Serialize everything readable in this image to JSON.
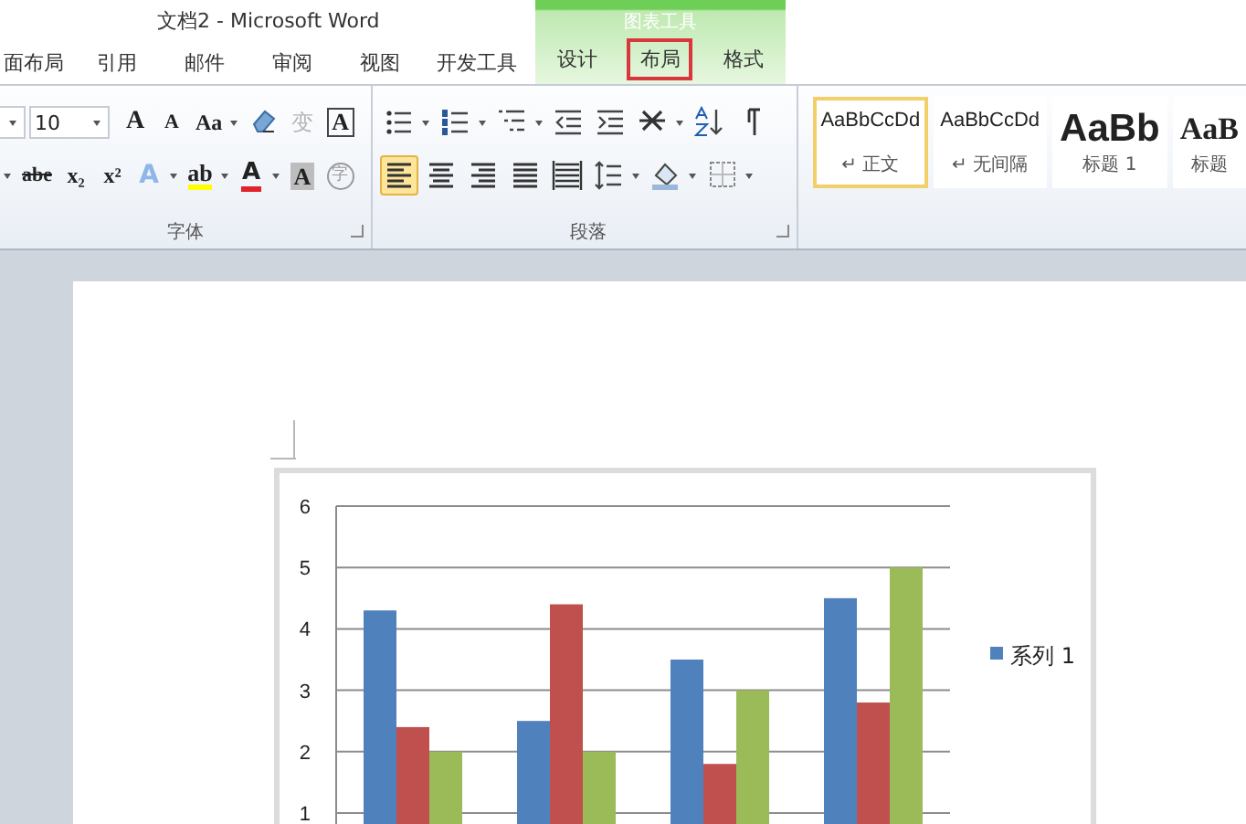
{
  "window": {
    "title": "文档2 - Microsoft Word"
  },
  "tabs": [
    {
      "label": "面布局",
      "highlighted": false
    },
    {
      "label": "引用",
      "highlighted": false
    },
    {
      "label": "邮件",
      "highlighted": false
    },
    {
      "label": "审阅",
      "highlighted": false
    },
    {
      "label": "视图",
      "highlighted": false
    },
    {
      "label": "开发工具",
      "highlighted": false
    }
  ],
  "contextual_tabs": {
    "title": "图表工具",
    "tabs": [
      {
        "label": "设计",
        "highlighted": false
      },
      {
        "label": "布局",
        "highlighted": true
      },
      {
        "label": "格式",
        "highlighted": false
      }
    ]
  },
  "font_group": {
    "label": "字体",
    "font_size": "10",
    "row1": [
      "A",
      "A",
      "Aa",
      "变",
      "A"
    ],
    "row2": [
      "abe",
      "x₂",
      "x²",
      "A",
      "ab",
      "A",
      "A",
      "字"
    ]
  },
  "paragraph_group": {
    "label": "段落",
    "align_buttons": [
      {
        "selected": true
      },
      {
        "selected": false
      },
      {
        "selected": false
      },
      {
        "selected": false
      },
      {
        "selected": false
      }
    ]
  },
  "styles": [
    {
      "sample": "AaBbCcDd",
      "name": "正文",
      "mark": "↵",
      "selected": true
    },
    {
      "sample": "AaBbCcDd",
      "name": "无间隔",
      "mark": "↵",
      "selected": false
    },
    {
      "sample": "AaBb",
      "name": "标题 1",
      "selected": false
    },
    {
      "sample": "AaB",
      "name": "标题",
      "selected": false
    }
  ],
  "chart": {
    "chart_data": {
      "type": "bar",
      "ylim": [
        0,
        6
      ],
      "yticks": [
        1,
        2,
        3,
        4,
        5,
        6
      ],
      "grid": true,
      "series": [
        {
          "name": "系列 1",
          "color": "#4f81bd",
          "values": [
            4.3,
            2.5,
            3.5,
            4.5
          ]
        },
        {
          "color": "#c0504d",
          "values": [
            2.4,
            4.4,
            1.8,
            2.8
          ]
        },
        {
          "color": "#9bbb59",
          "values": [
            2,
            2,
            3,
            5
          ]
        }
      ]
    }
  }
}
